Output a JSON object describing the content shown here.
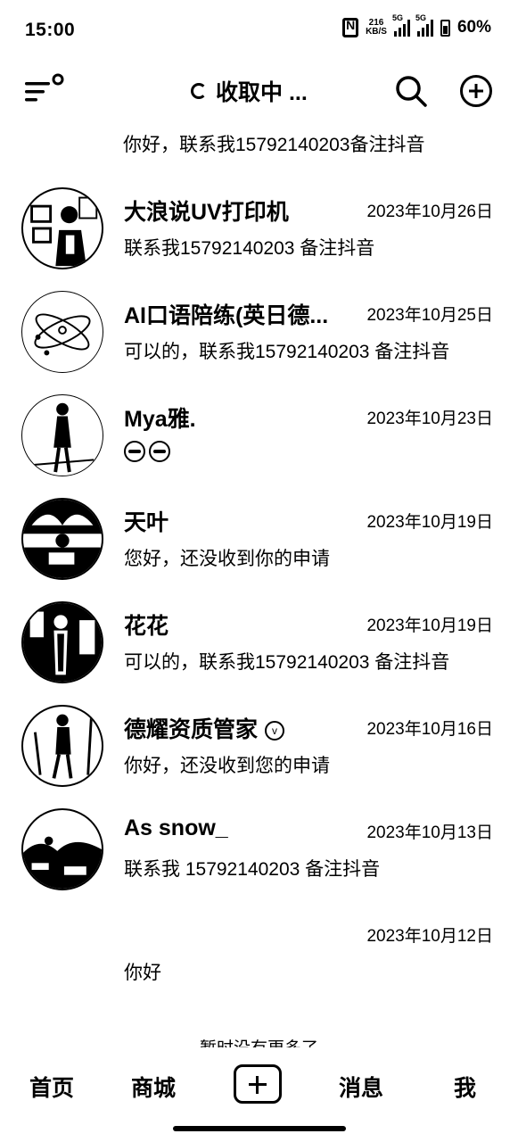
{
  "status_bar": {
    "time": "15:00",
    "net_speed_top": "216",
    "net_speed_bottom": "KB/S",
    "sim1": "5G",
    "sim2": "5G",
    "battery": "60%"
  },
  "header": {
    "title": "收取中 ..."
  },
  "first_snippet": "你好，联系我15792140203备注抖音",
  "chats": [
    {
      "name": "大浪说UV打印机",
      "date": "2023年10月26日",
      "message": "联系我15792140203 备注抖音"
    },
    {
      "name": "AI口语陪练(英日德...",
      "date": "2023年10月25日",
      "message": "可以的，联系我15792140203 备注抖音"
    },
    {
      "name": "Mya雅.",
      "date": "2023年10月23日",
      "message": ""
    },
    {
      "name": "天叶",
      "date": "2023年10月19日",
      "message": "您好，还没收到你的申请"
    },
    {
      "name": "花花",
      "date": "2023年10月19日",
      "message": "可以的，联系我15792140203 备注抖音"
    },
    {
      "name": "德耀资质管家",
      "date": "2023年10月16日",
      "message": "你好，还没收到您的申请"
    },
    {
      "name": "As snow_",
      "date": "2023年10月13日",
      "message": "联系我 15792140203 备注抖音"
    },
    {
      "name": "",
      "date": "2023年10月12日",
      "message": "你好"
    }
  ],
  "no_more_text": "暂时没有更多了",
  "bottom_nav": {
    "home": "首页",
    "mall": "商城",
    "messages": "消息",
    "me": "我"
  },
  "icons": {
    "menu": "menu-icon",
    "search": "search-icon",
    "add": "add-circle-icon",
    "verified": "verified-icon",
    "publish": "plus-box-icon"
  }
}
